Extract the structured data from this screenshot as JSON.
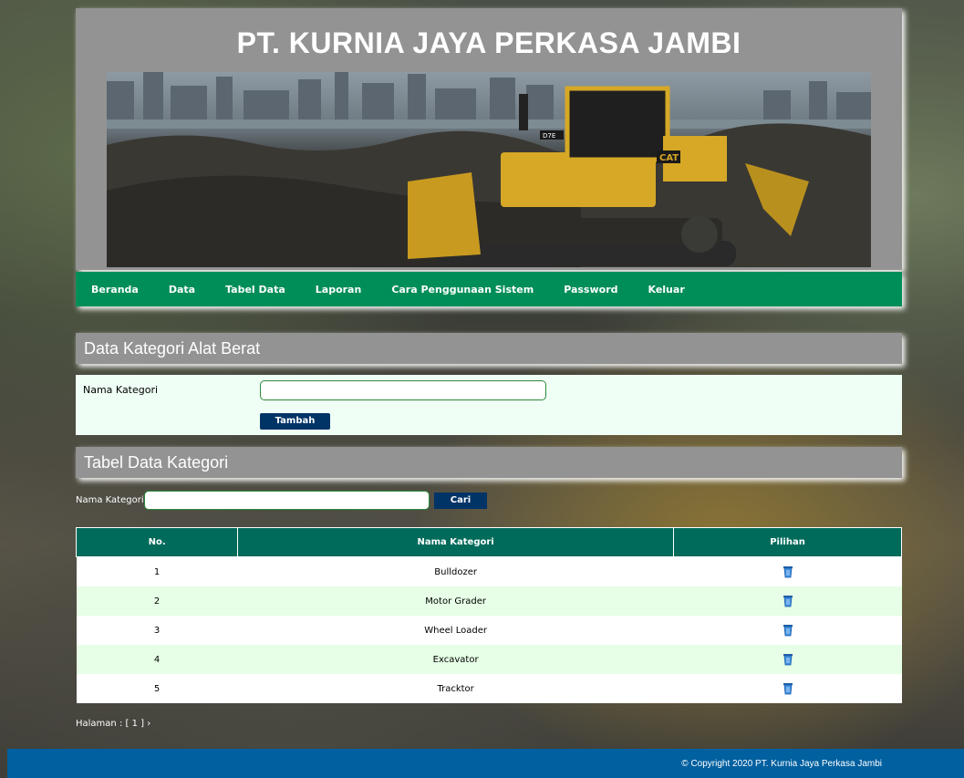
{
  "header": {
    "title": "PT. KURNIA JAYA PERKASA JAMBI"
  },
  "nav": {
    "items": [
      {
        "label": "Beranda"
      },
      {
        "label": "Data"
      },
      {
        "label": "Tabel Data"
      },
      {
        "label": "Laporan"
      },
      {
        "label": "Cara Penggunaan Sistem"
      },
      {
        "label": "Password"
      },
      {
        "label": "Keluar"
      }
    ]
  },
  "form": {
    "title": "Data Kategori Alat Berat",
    "field_label": "Nama Kategori",
    "field_value": "",
    "submit_label": "Tambah"
  },
  "table_section": {
    "title": "Tabel Data Kategori",
    "search_label": "Nama Kategori:",
    "search_value": "",
    "search_button": "Cari",
    "columns": [
      "No.",
      "Nama Kategori",
      "Pilihan"
    ],
    "rows": [
      {
        "no": "1",
        "name": "Bulldozer"
      },
      {
        "no": "2",
        "name": "Motor Grader"
      },
      {
        "no": "3",
        "name": "Wheel Loader"
      },
      {
        "no": "4",
        "name": "Excavator"
      },
      {
        "no": "5",
        "name": "Tracktor"
      }
    ],
    "action_icon": "trash-icon",
    "pagination": "Halaman : [ 1 ] ›"
  },
  "footer": {
    "text": "© Copyright 2020 PT. Kurnia Jaya Perkasa Jambi"
  },
  "colors": {
    "nav_bg": "#008e58",
    "header_bg": "#939393",
    "table_header_bg": "#006b5b",
    "button_bg": "#003366",
    "footer_bg": "#0060a0",
    "form_bg": "#effff5",
    "row_alt_bg": "#e6ffe6"
  }
}
